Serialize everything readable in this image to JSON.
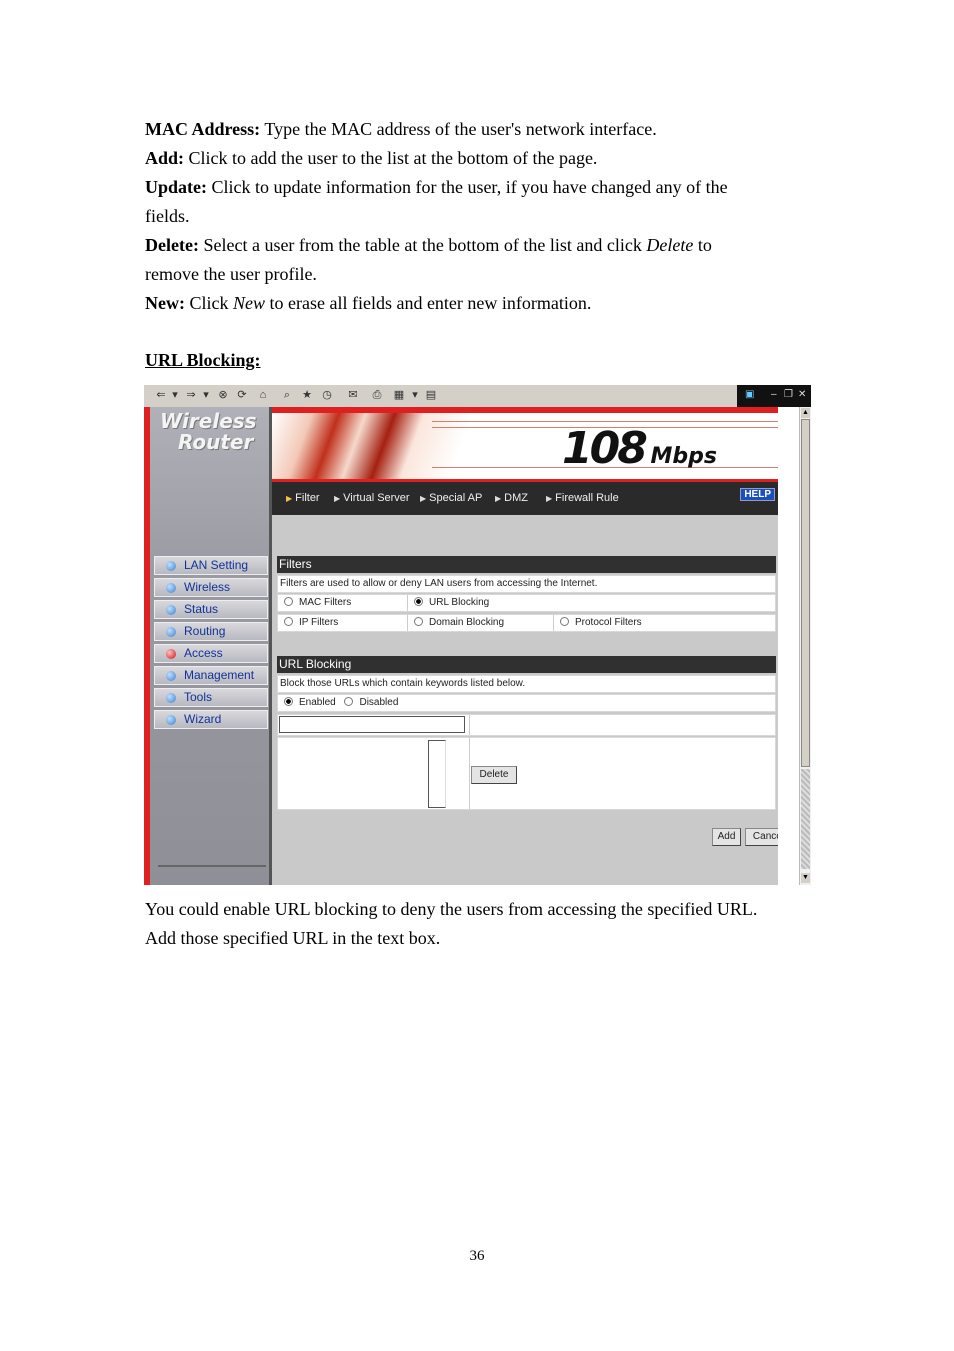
{
  "doc": {
    "mac": {
      "term": "MAC Address:",
      "desc": " Type the MAC address of the user's network interface."
    },
    "add": {
      "term": "Add:",
      "desc": " Click to add the user to the list at the bottom of the page."
    },
    "update": {
      "term": "Update:",
      "desc": " Click to update information for the user, if you have changed any of the",
      "desc2": "fields."
    },
    "delete": {
      "term": "Delete:",
      "desc": " Select a user from the table at the bottom of the list and click ",
      "em": "Delete",
      "after": " to",
      "desc2": "remove the user profile."
    },
    "new": {
      "term": "New:",
      "desc": " Click ",
      "em": "New",
      "after": " to erase all fields and enter new information."
    },
    "section_heading": "URL Blocking:",
    "caption1": "You could enable URL blocking to deny the users from accessing the specified URL.",
    "caption2": "Add those specified URL in the text box.",
    "page_number": "36"
  },
  "screenshot": {
    "brand_line1": "Wireless",
    "brand_line2": "Router",
    "speed_num": "108",
    "speed_unit": "Mbps",
    "tabs": [
      "Filter",
      "Virtual Server",
      "Special AP",
      "DMZ",
      "Firewall Rule"
    ],
    "help": "HELP",
    "nav": [
      "LAN Setting",
      "Wireless",
      "Status",
      "Routing",
      "Access",
      "Management",
      "Tools",
      "Wizard"
    ],
    "nav_active": "Access",
    "filters": {
      "title": "Filters",
      "desc": "Filters are used to allow or deny LAN users from accessing the Internet.",
      "options": [
        "MAC Filters",
        "URL Blocking",
        "IP Filters",
        "Domain Blocking",
        "Protocol Filters"
      ],
      "selected": "URL Blocking"
    },
    "url_blocking": {
      "title": "URL Blocking",
      "desc": "Block those URLs which contain keywords listed below.",
      "enabled_label": "Enabled",
      "disabled_label": "Disabled",
      "state": "Enabled",
      "url_input_value": "",
      "delete_label": "Delete",
      "add_label": "Add",
      "cancel_label": "Cancel"
    }
  }
}
